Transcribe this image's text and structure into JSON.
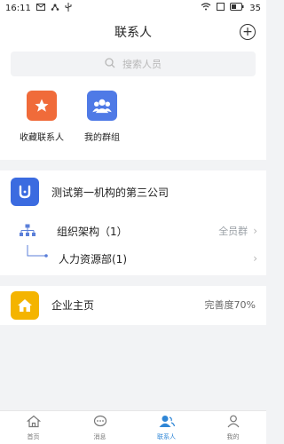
{
  "status_bar": {
    "time": "16:11",
    "battery": "35"
  },
  "header": {
    "title": "联系人"
  },
  "search": {
    "placeholder": "搜索人员"
  },
  "quick": {
    "favorites_label": "收藏联系人",
    "groups_label": "我的群组"
  },
  "org": {
    "name": "测试第一机构的第三公司",
    "structure_label": "组织架构（1）",
    "structure_right": "全员群",
    "department_label": "人力资源部(1)"
  },
  "company": {
    "label": "企业主页",
    "completeness": "完善度70%"
  },
  "nav": {
    "items": [
      {
        "label": "首页"
      },
      {
        "label": "消息"
      },
      {
        "label": "联系人"
      },
      {
        "label": "我的"
      }
    ]
  },
  "colors": {
    "accent": "#2f86d6",
    "favorites_tile": "#f06b3a",
    "groups_tile": "#4f7ae6",
    "org_logo": "#3b6be0",
    "company_icon": "#f4b400"
  }
}
